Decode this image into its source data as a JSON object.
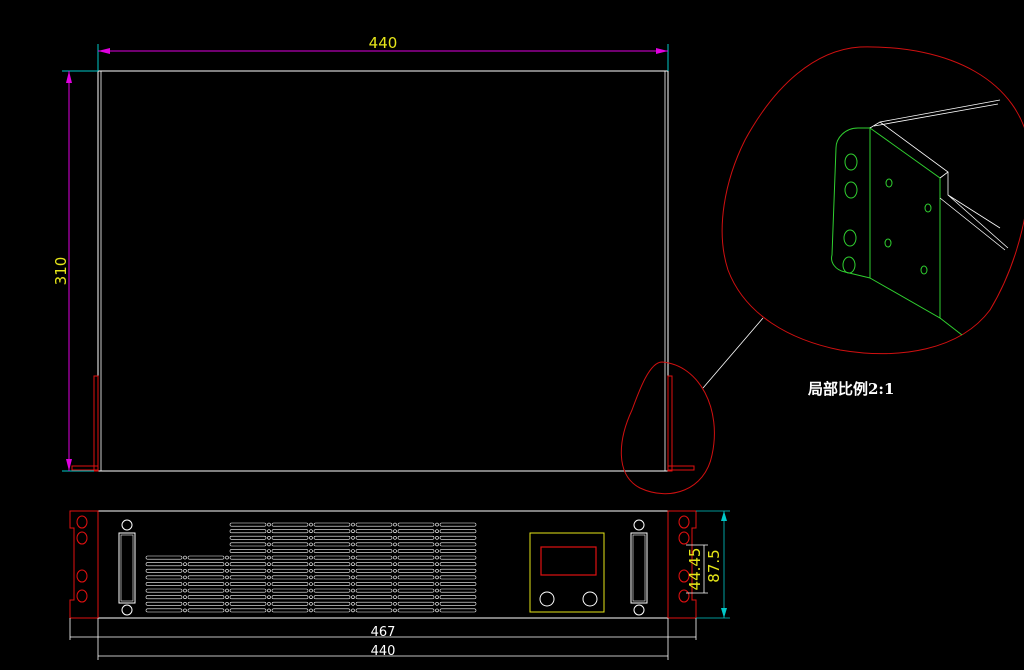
{
  "drawing": {
    "top_view": {
      "width_label": "440",
      "depth_label": "310"
    },
    "front_view": {
      "overall_width_label": "467",
      "body_width_label": "440",
      "height_label": "87.5",
      "hole_spacing_label": "44.45"
    },
    "detail_note": "局部比例2:1"
  },
  "colors": {
    "background": "#000000",
    "outline": "#ffffff",
    "dimension_line": "#e000e0",
    "dimension_text": "#e6e619",
    "detail_circle": "#d01010",
    "bracket": "#e01010",
    "ext_line_cyan": "#00c8c8",
    "detail_green": "#30d030"
  }
}
